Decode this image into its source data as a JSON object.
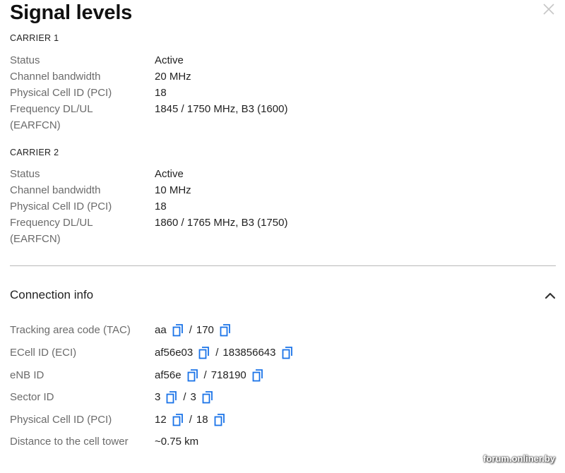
{
  "header": {
    "title": "Signal levels"
  },
  "carriers": [
    {
      "heading": "CARRIER 1",
      "rows": [
        {
          "label": "Status",
          "value": "Active"
        },
        {
          "label": "Channel bandwidth",
          "value": "20 MHz"
        },
        {
          "label": "Physical Cell ID (PCI)",
          "value": "18"
        },
        {
          "label": "Frequency DL/UL",
          "label2": "(EARFCN)",
          "value": "1845 / 1750 MHz, B3 (1600)"
        }
      ]
    },
    {
      "heading": "CARRIER 2",
      "rows": [
        {
          "label": "Status",
          "value": "Active"
        },
        {
          "label": "Channel bandwidth",
          "value": "10 MHz"
        },
        {
          "label": "Physical Cell ID (PCI)",
          "value": "18"
        },
        {
          "label": "Frequency DL/UL",
          "label2": "(EARFCN)",
          "value": "1860 / 1765 MHz, B3 (1750)"
        }
      ]
    }
  ],
  "connection": {
    "title": "Connection info",
    "rows": [
      {
        "label": "Tracking area code (TAC)",
        "hex": "aa",
        "sep": "/",
        "dec": "170"
      },
      {
        "label": "ECell ID (ECI)",
        "hex": "af56e03",
        "sep": "/",
        "dec": "183856643"
      },
      {
        "label": "eNB ID",
        "hex": "af56e",
        "sep": "/",
        "dec": "718190"
      },
      {
        "label": "Sector ID",
        "hex": "3",
        "sep": "/",
        "dec": "3"
      },
      {
        "label": "Physical Cell ID (PCI)",
        "hex": "12",
        "sep": "/",
        "dec": "18"
      }
    ],
    "distance": {
      "label": "Distance to the cell tower",
      "value": "~0.75 km"
    }
  },
  "icons": {
    "copy": "copy-icon",
    "close": "close-icon",
    "collapse": "chevron-up-icon"
  },
  "colors": {
    "accent": "#1a73e8",
    "label": "#6b6b6b",
    "text": "#222222",
    "divider": "#b8b8b8"
  },
  "watermark": "forum.onliner.by"
}
